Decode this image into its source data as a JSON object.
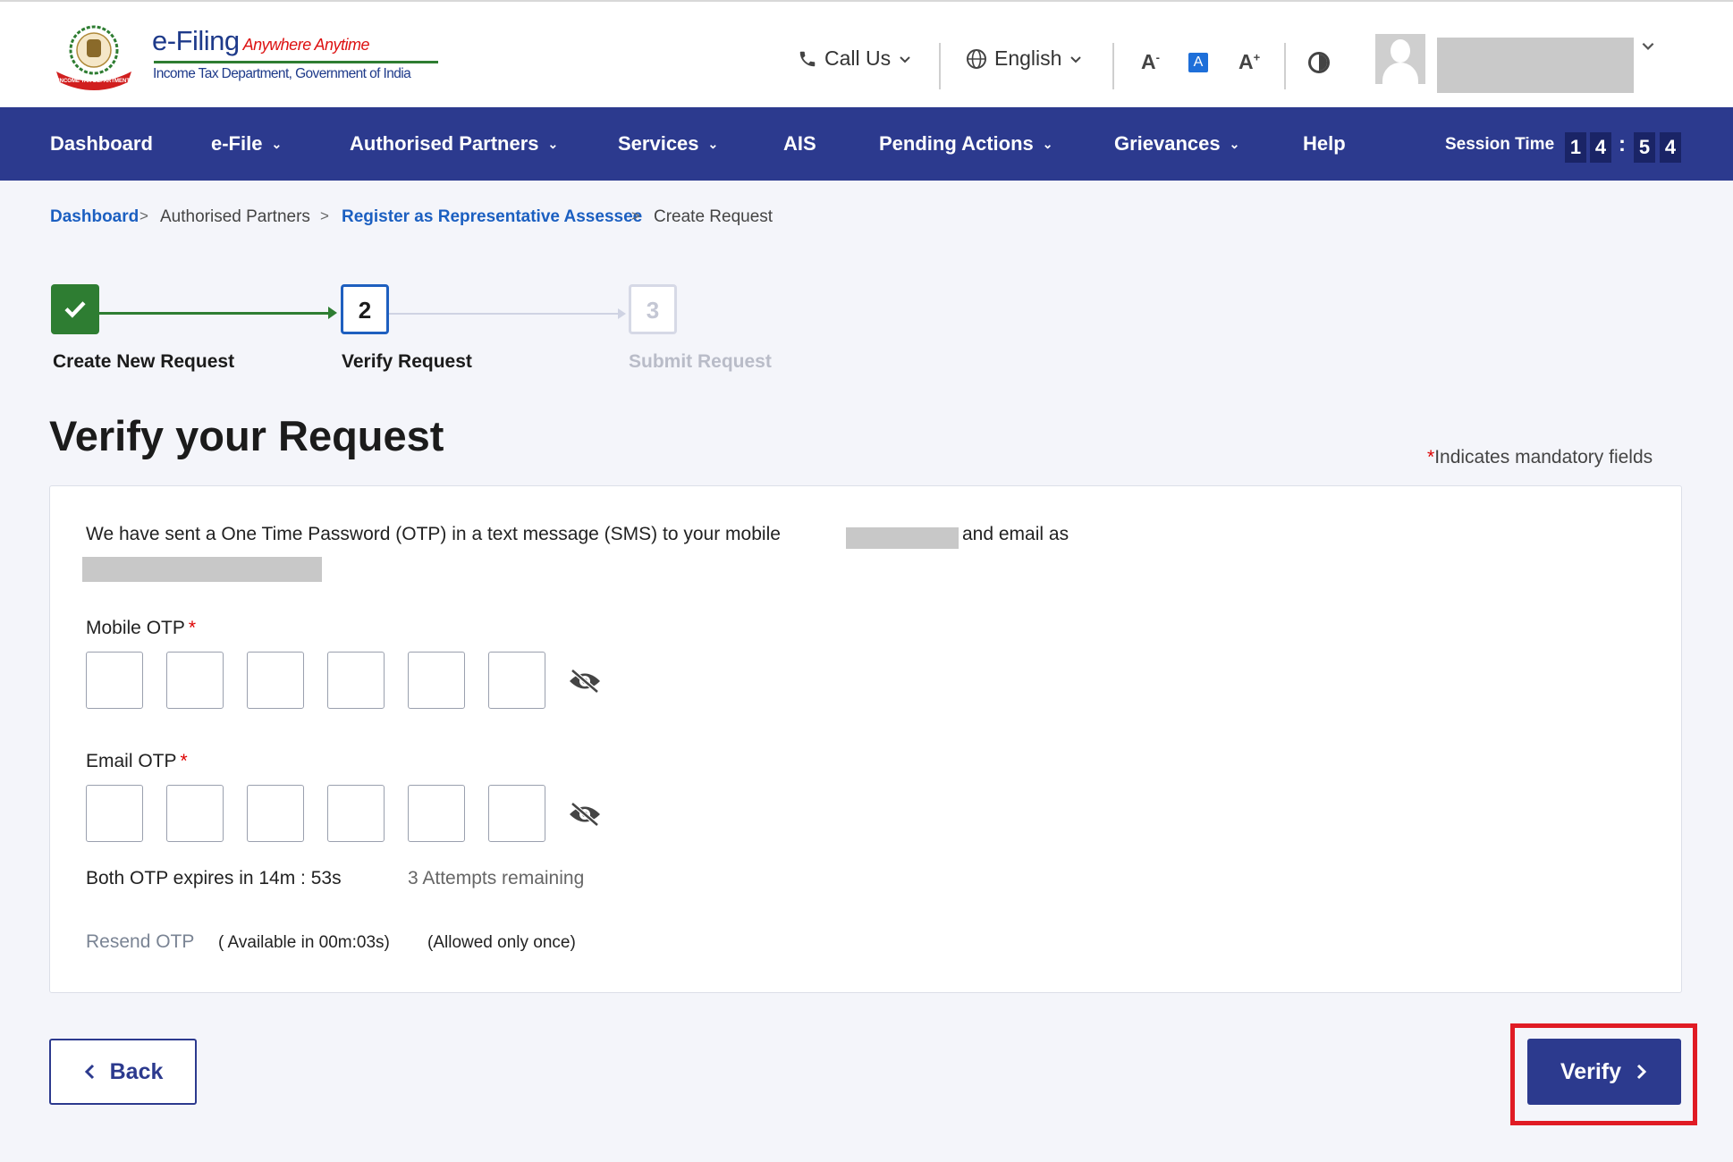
{
  "header": {
    "logo_title": "e-Filing",
    "logo_tagline": "Anywhere Anytime",
    "logo_subtitle": "Income Tax Department, Government of India",
    "emblem_ribbon": "INCOME TAX DEPARTMENT",
    "call_us": "Call Us",
    "language": "English",
    "font_decrease": "A",
    "font_normal": "A",
    "font_increase": "A",
    "font_decrease_mark": "-",
    "font_increase_mark": "+"
  },
  "nav": {
    "items": [
      "Dashboard",
      "e-File",
      "Authorised Partners",
      "Services",
      "AIS",
      "Pending Actions",
      "Grievances",
      "Help"
    ],
    "session_label": "Session Time",
    "session_digits": [
      "1",
      "4",
      "5",
      "4"
    ],
    "session_colon": ":"
  },
  "breadcrumb": {
    "items": [
      "Dashboard",
      "Authorised Partners",
      "Register as Representative Assessee",
      "Create Request"
    ],
    "separator": ">"
  },
  "stepper": {
    "steps": [
      {
        "number": "1",
        "label": "Create New Request",
        "state": "done"
      },
      {
        "number": "2",
        "label": "Verify Request",
        "state": "active"
      },
      {
        "number": "3",
        "label": "Submit Request",
        "state": "future"
      }
    ]
  },
  "page": {
    "title": "Verify your Request",
    "mandatory_star": "*",
    "mandatory_note": "Indicates mandatory fields"
  },
  "otp": {
    "message_part1": "We have sent a One Time Password (OTP) in a text message (SMS) to your mobile",
    "message_part2": "and email as",
    "mobile_label": "Mobile OTP",
    "email_label": "Email OTP",
    "required_mark": "*",
    "expires_text": "Both OTP expires in 14m : 53s",
    "attempts_text": "3 Attempts remaining",
    "resend_label": "Resend OTP",
    "resend_available": "( Available in 00m:03s)",
    "resend_allowed": "(Allowed only once)"
  },
  "actions": {
    "back_label": "Back",
    "verify_label": "Verify"
  },
  "icons": {
    "call": "phone-icon",
    "language": "globe-icon",
    "contrast": "contrast-icon",
    "avatar": "user-avatar-icon",
    "visibility": "eye-off-icon",
    "back": "chevron-left-icon",
    "verify": "chevron-right-icon",
    "step_done": "checkmark-icon"
  },
  "colors": {
    "navbar": "#2c3a8e",
    "primary_button": "#2c3a8e",
    "step_done": "#2e7d32",
    "step_active_border": "#1e5fbf",
    "link": "#1b5fc1",
    "required": "#dd0000",
    "highlight": "#e01b24"
  }
}
